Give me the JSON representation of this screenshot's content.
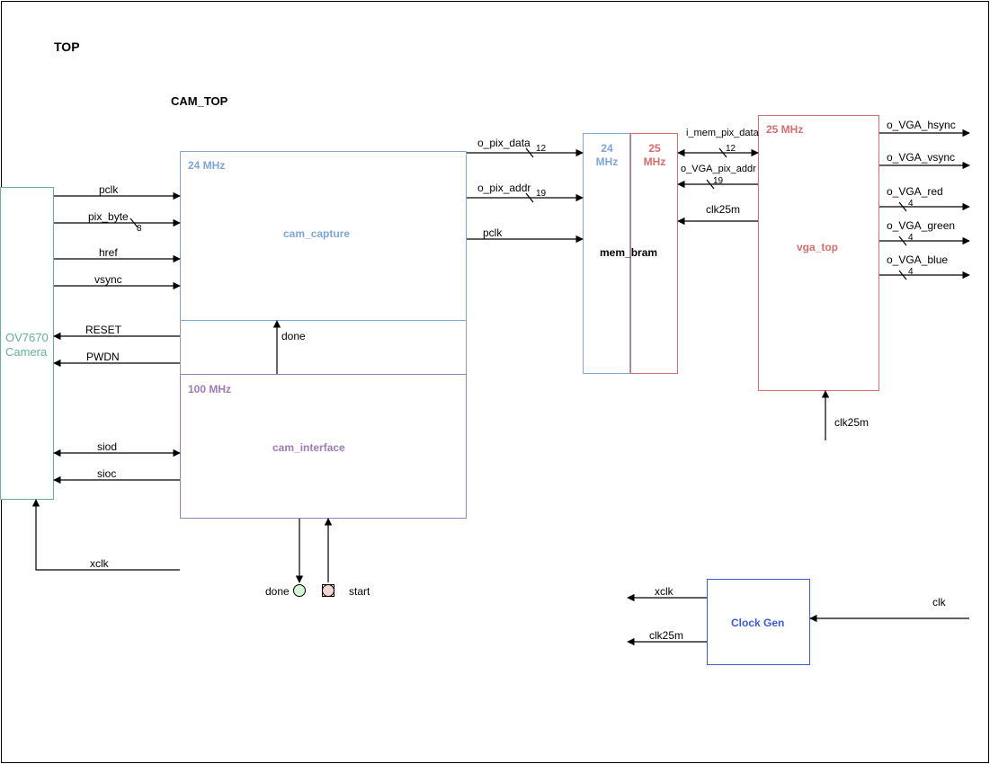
{
  "title": "TOP",
  "subtitle": "CAM_TOP",
  "blocks": {
    "camera": "OV7670\nCamera",
    "cam_capture": {
      "clk": "24 MHz",
      "name": "cam_capture"
    },
    "cam_interface": {
      "clk": "100 MHz",
      "name": "cam_interface"
    },
    "mem_bram": {
      "left": "24 MHz",
      "right": "25 MHz",
      "name": "mem_bram"
    },
    "vga_top": {
      "clk": "25 MHz",
      "name": "vga_top"
    },
    "clock_gen": "Clock Gen"
  },
  "signals": {
    "pclk": "pclk",
    "pix_byte": "pix_byte",
    "pix_byte_w": "8",
    "href": "href",
    "vsync": "vsync",
    "reset": "RESET",
    "pwdn": "PWDN",
    "siod": "siod",
    "sioc": "sioc",
    "xclk": "xclk",
    "done": "done",
    "start": "start",
    "o_pix_data": "o_pix_data",
    "o_pix_data_w": "12",
    "o_pix_addr": "o_pix_addr",
    "o_pix_addr_w": "19",
    "i_mem_pix_data": "i_mem_pix_data",
    "i_mem_pix_data_w": "12",
    "o_vga_pix_addr": "o_VGA_pix_addr",
    "o_vga_pix_addr_w": "19",
    "clk25m": "clk25m",
    "o_vga_hsync": "o_VGA_hsync",
    "o_vga_vsync": "o_VGA_vsync",
    "o_vga_red": "o_VGA_red",
    "o_vga_green": "o_VGA_green",
    "o_vga_blue": "o_VGA_blue",
    "vga_color_w": "4",
    "clk": "clk"
  }
}
